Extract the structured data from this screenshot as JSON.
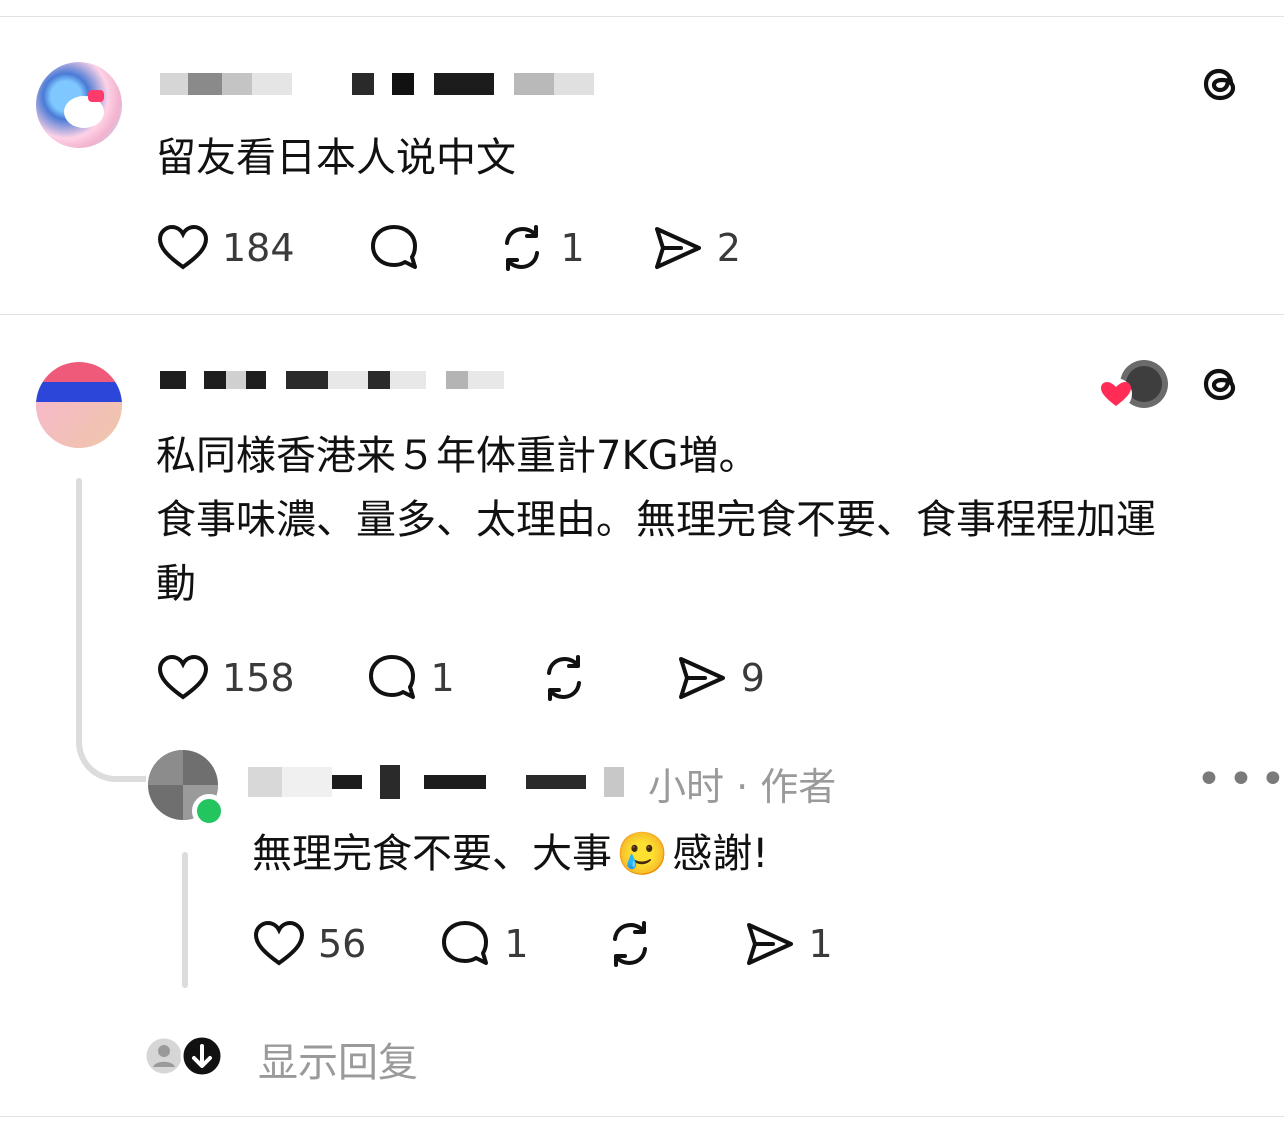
{
  "post1": {
    "text": "留友看日本人说中文",
    "likes": "184",
    "comments": "",
    "reposts": "1",
    "shares": "2"
  },
  "post2": {
    "text": "私同様香港来５年体重計7KG増。\n食事味濃、量多、太理由。無理完食不要、食事程程加運\n動",
    "likes": "158",
    "comments": "1",
    "reposts": "",
    "shares": "9"
  },
  "reply": {
    "meta": "小时 · 作者",
    "text_before_emoji": "無理完食不要、大事",
    "emoji": "🥲",
    "text_after_emoji": "感謝!",
    "likes": "56",
    "comments": "1",
    "reposts": "",
    "shares": "1"
  },
  "show_replies_label": "显示回复",
  "icons": {
    "like": "heart-icon",
    "comment": "comment-bubble-icon",
    "repost": "repost-icon",
    "share": "send-icon",
    "threads": "threads-logo-icon",
    "more": "more-options-icon"
  },
  "colors": {
    "text": "#111111",
    "muted": "#9a9a9a",
    "divider": "#e2e2e2",
    "online": "#22c55e",
    "heart_red": "#ff2d55"
  }
}
